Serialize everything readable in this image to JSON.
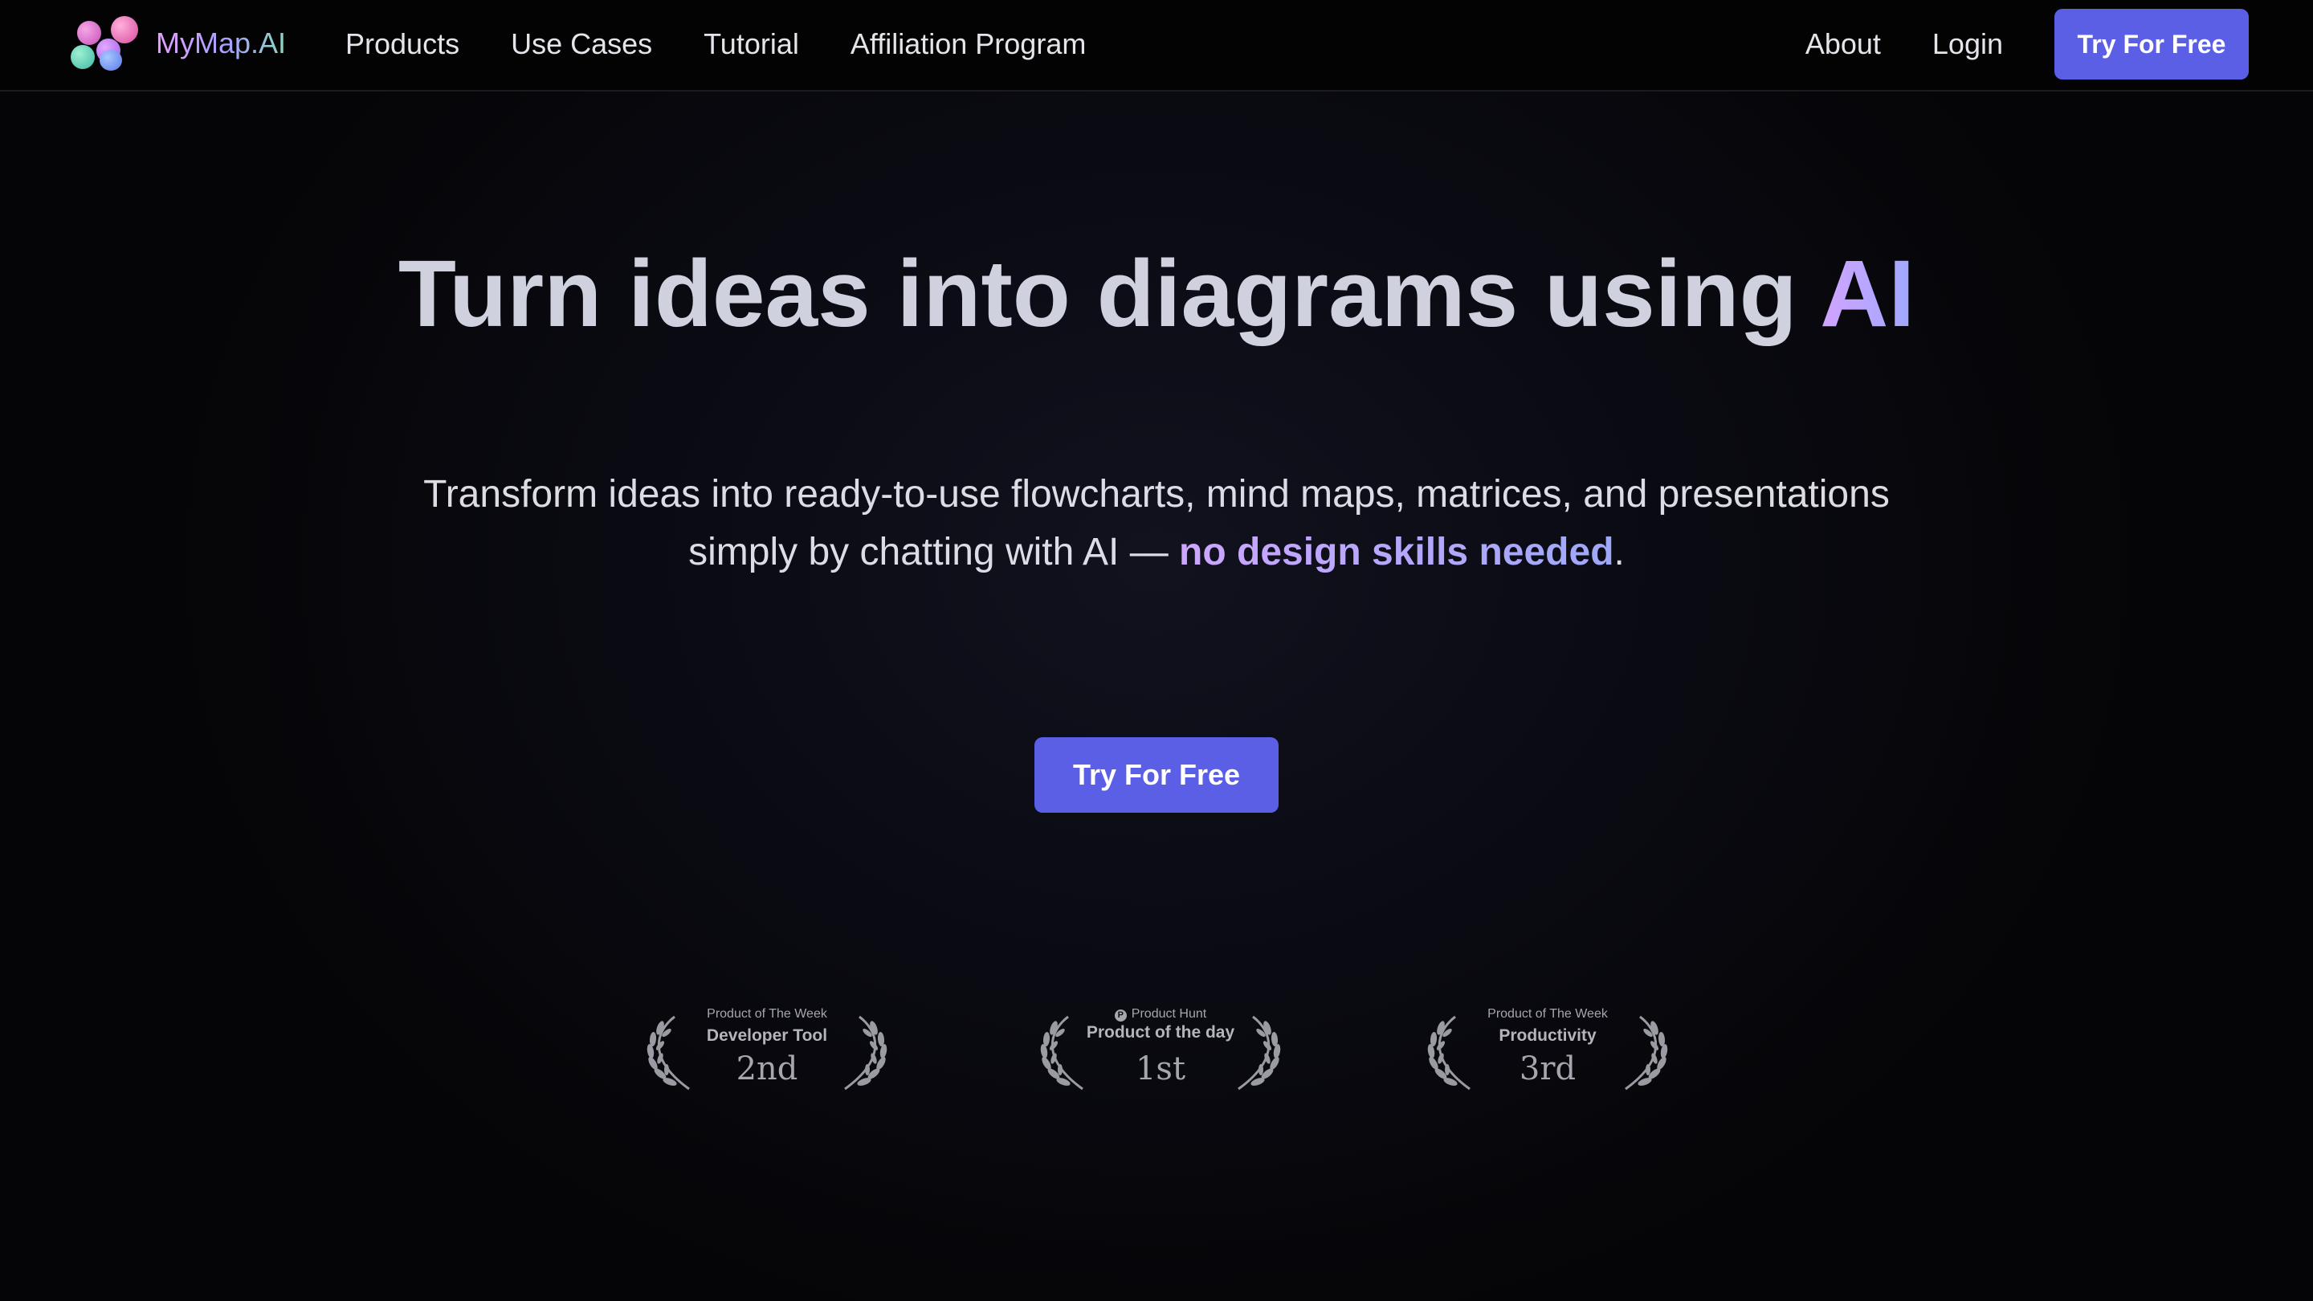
{
  "nav": {
    "brand": "MyMap.AI",
    "links": [
      "Products",
      "Use Cases",
      "Tutorial",
      "Affiliation Program"
    ],
    "right_links": [
      "About",
      "Login"
    ],
    "cta_label": "Try For Free"
  },
  "hero": {
    "title_main": "Turn ideas into diagrams using ",
    "title_accent": "AI",
    "subtitle_line1": "Transform ideas into ready-to-use flowcharts, mind maps, matrices, and presentations",
    "subtitle_line2_start": "simply by chatting with AI — ",
    "subtitle_accent": "no design skills needed",
    "subtitle_end": ".",
    "cta_label": "Try For Free"
  },
  "badges": [
    {
      "label_top": "Product of The Week",
      "category": "Developer Tool",
      "rank": "2nd"
    },
    {
      "label_top": "Product Hunt",
      "label_icon": "P",
      "category": "Product of the day",
      "rank": "1st"
    },
    {
      "label_top": "Product of The Week",
      "category": "Productivity",
      "rank": "3rd"
    }
  ],
  "colors": {
    "accent_button": "#5b5fe6",
    "background": "#050507",
    "title_text": "#cfd1de"
  },
  "icons": {
    "logo": "mymap-logo-icon",
    "laurel": "laurel-wreath-icon",
    "product_hunt": "product-hunt-icon"
  }
}
